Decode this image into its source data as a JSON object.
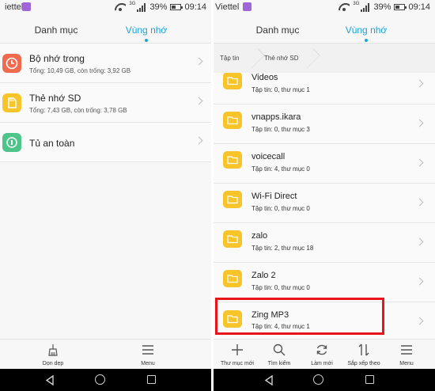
{
  "left": {
    "status": {
      "carrier": "iettel",
      "battery": "39%",
      "time": "09:14",
      "network": "3G"
    },
    "tabs": [
      "Danh mục",
      "Vùng nhớ"
    ],
    "active_tab": 1,
    "storage_items": [
      {
        "title": "Bộ nhớ trong",
        "subtitle": "Tổng: 10,49 GB, còn trống: 3,92 GB",
        "icon": "clock-icon",
        "color": "#ef6a4f"
      },
      {
        "title": "Thẻ nhớ SD",
        "subtitle": "Tổng: 7,43 GB, còn trống: 3,78 GB",
        "icon": "sd-card-icon",
        "color": "#f7c42a"
      },
      {
        "title": "Tủ an toàn",
        "subtitle": "",
        "icon": "safe-icon",
        "color": "#4cc48a"
      }
    ],
    "bottom": [
      {
        "label": "Dọn dẹp",
        "icon": "broom-icon"
      },
      {
        "label": "Menu",
        "icon": "menu-icon"
      }
    ]
  },
  "right": {
    "status": {
      "carrier": "Viettel",
      "battery": "39%",
      "time": "09:14",
      "network": "3G"
    },
    "tabs": [
      "Danh mục",
      "Vùng nhớ"
    ],
    "active_tab": 1,
    "breadcrumb": [
      "Tập tin",
      "Thẻ nhớ SD"
    ],
    "folders": [
      {
        "name": "Videos",
        "info": "Tập tin: 0, thư mục 1"
      },
      {
        "name": "vnapps.ikara",
        "info": "Tập tin: 0, thư mục 3"
      },
      {
        "name": "voicecall",
        "info": "Tập tin: 4, thư mục 0"
      },
      {
        "name": "Wi-Fi Direct",
        "info": "Tập tin: 0, thư mục 0"
      },
      {
        "name": "zalo",
        "info": "Tập tin: 2, thư mục 18"
      },
      {
        "name": "Zalo 2",
        "info": "Tập tin: 0, thư mục 0"
      },
      {
        "name": "Zing MP3",
        "info": "Tập tin: 4, thư mục 1"
      }
    ],
    "highlighted_folder": "Zing MP3",
    "bottom": [
      {
        "label": "Thư mục mới",
        "icon": "plus-icon"
      },
      {
        "label": "Tìm kiếm",
        "icon": "search-icon"
      },
      {
        "label": "Làm mới",
        "icon": "refresh-icon"
      },
      {
        "label": "Sắp xếp theo",
        "icon": "sort-icon"
      },
      {
        "label": "Menu",
        "icon": "menu-icon"
      }
    ]
  },
  "colors": {
    "accent": "#1aa3d9",
    "folder": "#f7c42a",
    "highlight": "#e8141c"
  }
}
